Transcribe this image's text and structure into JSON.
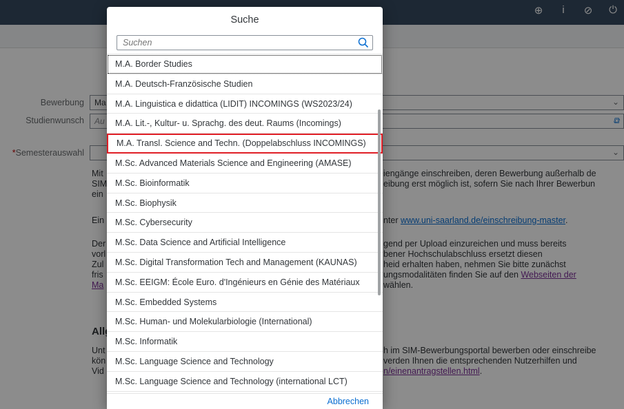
{
  "background": {
    "form": {
      "bewerbung_label": "Bewerbung",
      "bewerbung_value": "Ma",
      "studienwunsch_label": "Studienwunsch",
      "studienwunsch_placeholder": "Au",
      "semester_label": "Semesterauswahl",
      "semester_required": "*"
    },
    "left_fragments": [
      "Mit",
      "SIM",
      "ein",
      "Ein",
      "Der",
      "vorl",
      "Zul",
      "fris",
      "Ma",
      "Allg",
      "Unt",
      "kön",
      "Vid"
    ],
    "right_fragments": {
      "line1": "iengänge einschreiben, deren Bewerbung außerhalb de",
      "line2": "eibung erst möglich ist, sofern Sie nach Ihrer Bewerbun",
      "line3_prefix": "nter ",
      "line3_link": "www.uni-saarland.de/einschreibung-master",
      "line3_suffix": ".",
      "line4": "gend per Upload einzureichen und muss bereits",
      "line5": "bener Hochschulabschluss ersetzt diesen",
      "line6": "heid erhalten haben, nehmen Sie bitte zunächst",
      "line7_prefix": "ungsmodalitäten finden Sie auf den ",
      "line7_link": "Webseiten der",
      "line8": "wählen.",
      "line9": "h im SIM-Bewerbungsportal bewerben oder einschreibe",
      "line10": "verden Ihnen die entsprechenden Nutzerhilfen und",
      "line11_link": "n/einenantragstellen.html",
      "line11_suffix": "."
    },
    "shell_icons": [
      "globe-icon",
      "info-icon",
      "help-icon",
      "power-icon"
    ],
    "shell_glyphs": [
      "⊕",
      "i",
      "⊘",
      "⏻"
    ]
  },
  "dialog": {
    "title": "Suche",
    "search_placeholder": "Suchen",
    "items": [
      "M.A. Border Studies",
      "M.A. Deutsch-Französische Studien",
      "M.A. Linguistica e didattica (LIDIT) INCOMINGS (WS2023/24)",
      "M.A. Lit.-, Kultur- u. Sprachg. des deut. Raums (Incomings)",
      "M.A. Transl. Science and Techn. (Doppelabschluss INCOMINGS)",
      "M.Sc. Advanced Materials Science and Engineering (AMASE)",
      "M.Sc. Bioinformatik",
      "M.Sc. Biophysik",
      "M.Sc. Cybersecurity",
      "M.Sc. Data Science and Artificial Intelligence",
      "M.Sc. Digital Transformation Tech and Management (KAUNAS)",
      "M.Sc. EEIGM: École Euro. d'Ingénieurs en Génie des Matériaux",
      "M.Sc. Embedded Systems",
      "M.Sc. Human- und Molekularbiologie (International)",
      "M.Sc. Informatik",
      "M.Sc. Language Science and Technology",
      "M.Sc. Language Science and Technology (international LCT)"
    ],
    "cancel_label": "Abbrechen"
  },
  "colors": {
    "highlight_border": "#e01e26",
    "link": "#0a6ed1",
    "shell": "#354a5f"
  }
}
